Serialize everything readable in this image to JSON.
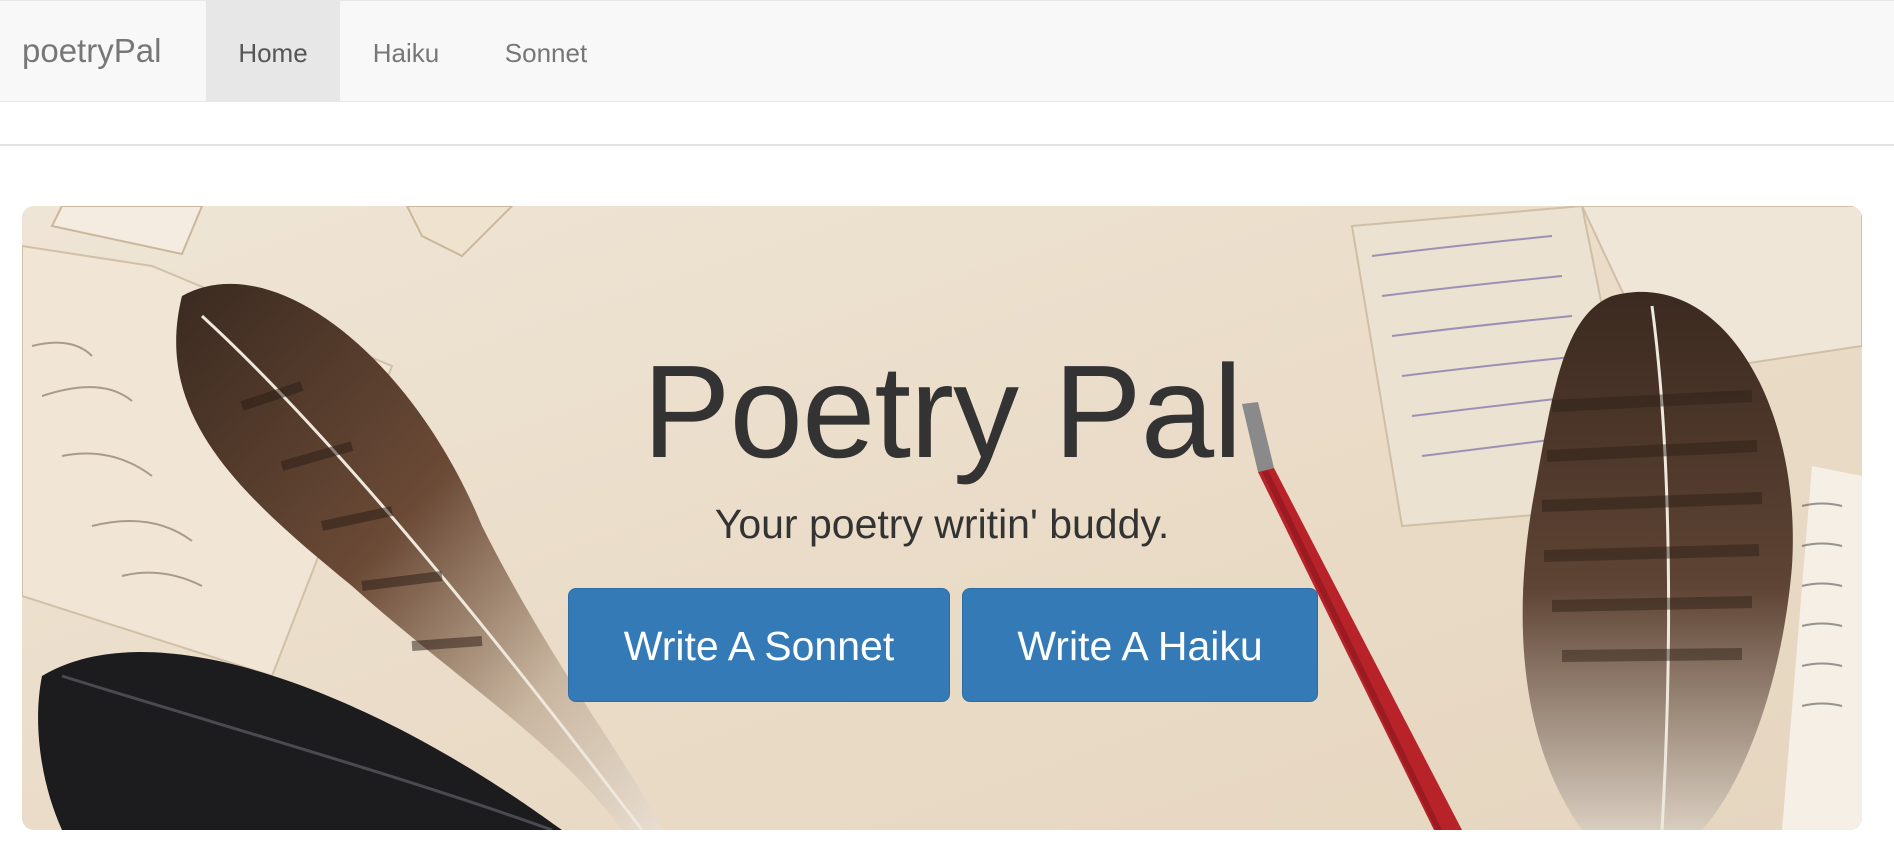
{
  "navbar": {
    "brand": "poetryPal",
    "items": [
      {
        "label": "Home",
        "active": true
      },
      {
        "label": "Haiku",
        "active": false
      },
      {
        "label": "Sonnet",
        "active": false
      }
    ]
  },
  "hero": {
    "title": "Poetry Pal",
    "subtitle": "Your poetry writin' buddy.",
    "buttons": [
      {
        "label": "Write A Sonnet"
      },
      {
        "label": "Write A Haiku"
      }
    ]
  },
  "colors": {
    "navbar_bg": "#f8f8f8",
    "nav_active_bg": "#e7e7e7",
    "button_primary": "#337ab7",
    "hero_text": "#333333"
  },
  "icons": [
    "feather-left-brown",
    "feather-left-black",
    "feather-right",
    "fountain-pen",
    "postcards"
  ]
}
